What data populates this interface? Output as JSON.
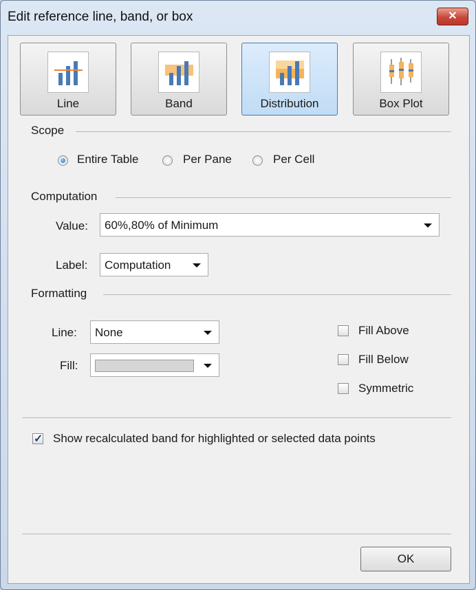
{
  "window": {
    "title": "Edit reference line, band, or box",
    "close_glyph": "✕"
  },
  "type_buttons": [
    {
      "label": "Line",
      "icon": "reference-line-icon",
      "selected": false
    },
    {
      "label": "Band",
      "icon": "reference-band-icon",
      "selected": false
    },
    {
      "label": "Distribution",
      "icon": "distribution-icon",
      "selected": true
    },
    {
      "label": "Box Plot",
      "icon": "box-plot-icon",
      "selected": false
    }
  ],
  "scope": {
    "heading": "Scope",
    "options": [
      {
        "label": "Entire Table",
        "checked": true
      },
      {
        "label": "Per Pane",
        "checked": false
      },
      {
        "label": "Per Cell",
        "checked": false
      }
    ]
  },
  "computation": {
    "heading": "Computation",
    "value_label": "Value:",
    "value": "60%,80% of Minimum",
    "label_label": "Label:",
    "label_value": "Computation"
  },
  "formatting": {
    "heading": "Formatting",
    "line_label": "Line:",
    "line_value": "None",
    "fill_label": "Fill:",
    "checkboxes": [
      {
        "label": "Fill Above",
        "checked": false
      },
      {
        "label": "Fill Below",
        "checked": false
      },
      {
        "label": "Symmetric",
        "checked": false
      }
    ]
  },
  "show_recalculated": {
    "label": "Show recalculated band for highlighted or selected data points",
    "checked": true
  },
  "ok_label": "OK",
  "colors": {
    "bar_blue": "#4a7ab5",
    "band_orange": "#f5b35a",
    "line_orange": "#e8833a",
    "selected_border": "#3c7fb1"
  }
}
